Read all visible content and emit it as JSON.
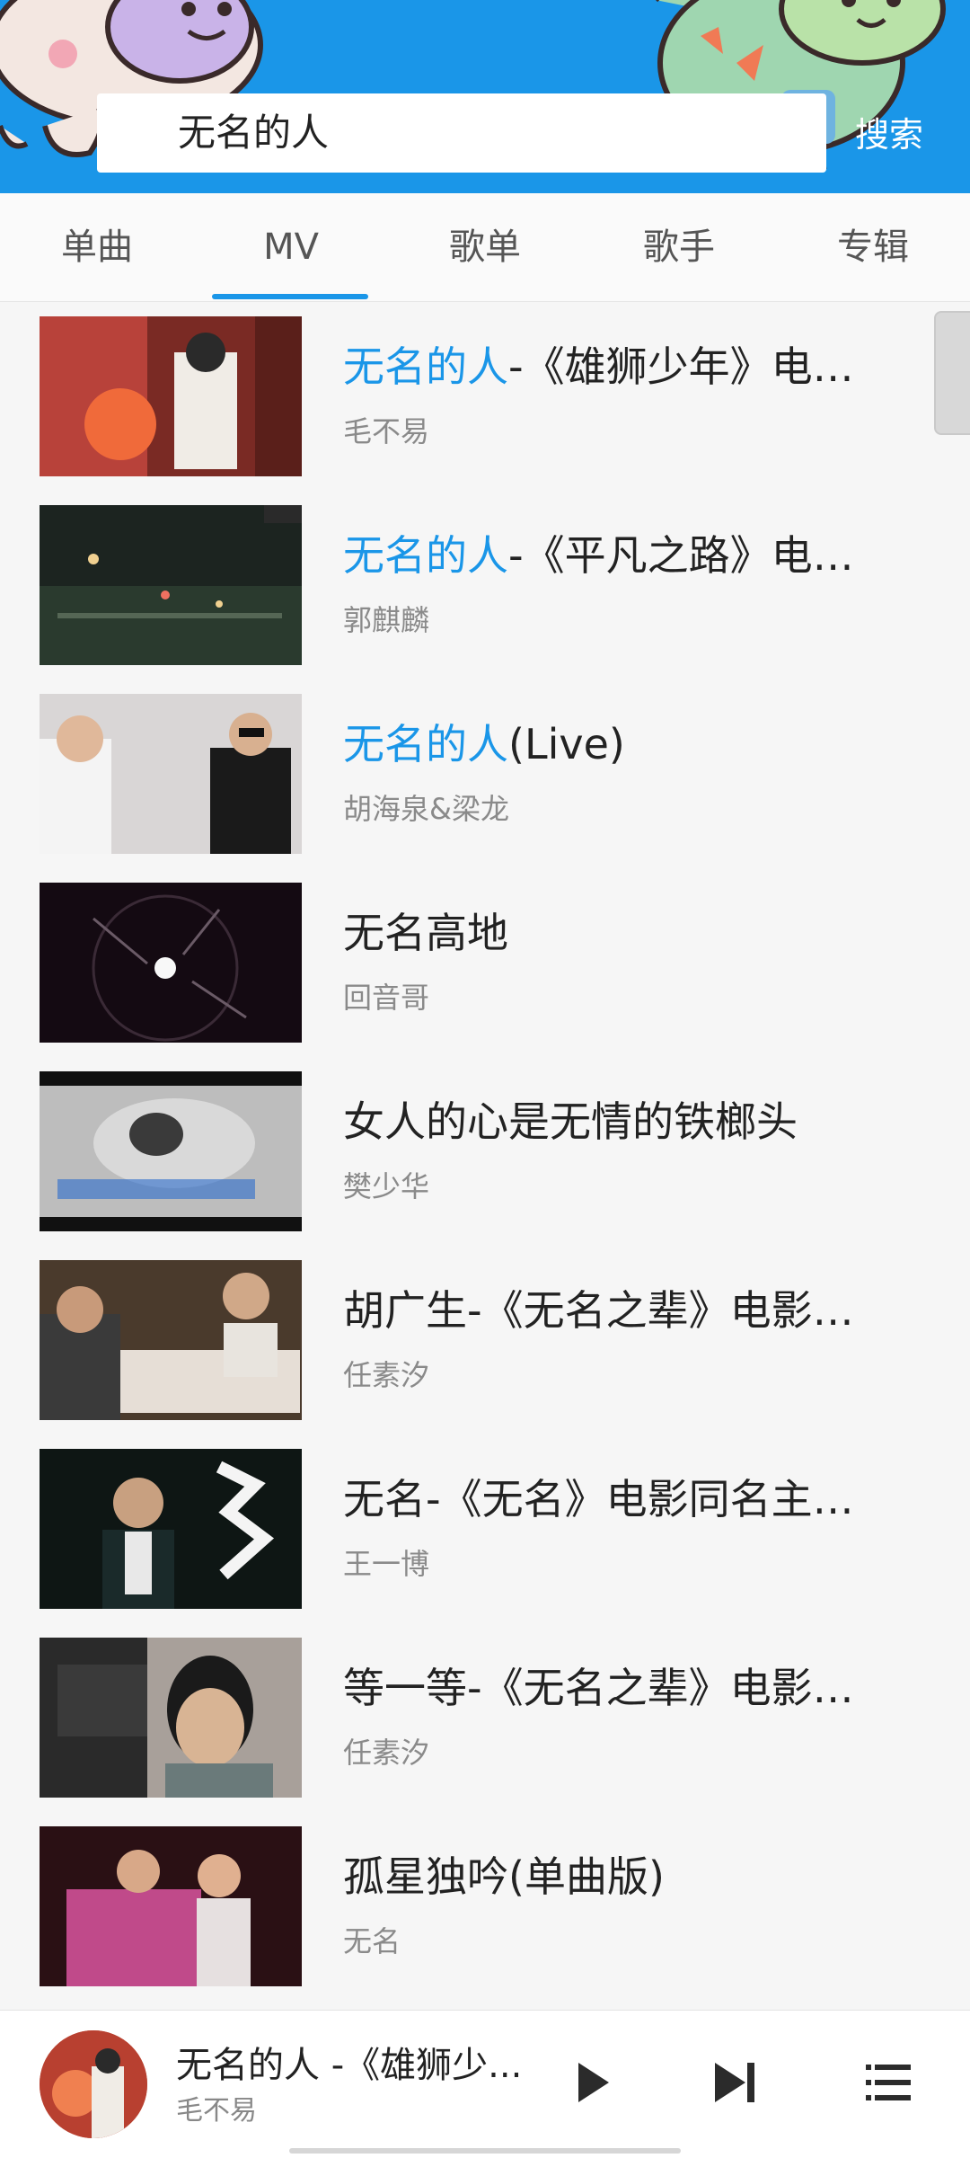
{
  "search": {
    "query": "无名的人",
    "button_label": "搜索"
  },
  "tabs": [
    {
      "label": "单曲"
    },
    {
      "label": "MV",
      "active": true
    },
    {
      "label": "歌单"
    },
    {
      "label": "歌手"
    },
    {
      "label": "专辑"
    }
  ],
  "results": [
    {
      "title_highlight": "无名的人",
      "title_rest": "-《雄狮少年》电…",
      "artist": "毛不易"
    },
    {
      "title_highlight": "无名的人",
      "title_rest": "-《平凡之路》电…",
      "artist": "郭麒麟"
    },
    {
      "title_highlight": "无名的人",
      "title_rest": "(Live)",
      "artist": "胡海泉&梁龙"
    },
    {
      "title_highlight": "",
      "title_rest": "无名高地",
      "artist": "回音哥"
    },
    {
      "title_highlight": "",
      "title_rest": "女人的心是无情的铁榔头",
      "artist": "樊少华"
    },
    {
      "title_highlight": "",
      "title_rest": "胡广生-《无名之辈》电影…",
      "artist": "任素汐"
    },
    {
      "title_highlight": "",
      "title_rest": "无名-《无名》电影同名主…",
      "artist": "王一博"
    },
    {
      "title_highlight": "",
      "title_rest": "等一等-《无名之辈》电影…",
      "artist": "任素汐"
    },
    {
      "title_highlight": "",
      "title_rest": "孤星独吟(单曲版)",
      "artist": "无名"
    }
  ],
  "player": {
    "title": "无名的人 -《雄狮少...",
    "artist": "毛不易"
  },
  "colors": {
    "accent": "#1a96e8",
    "header_bg": "#1a96e8"
  },
  "icons": [
    "play-icon",
    "next-track-icon",
    "playlist-icon"
  ]
}
